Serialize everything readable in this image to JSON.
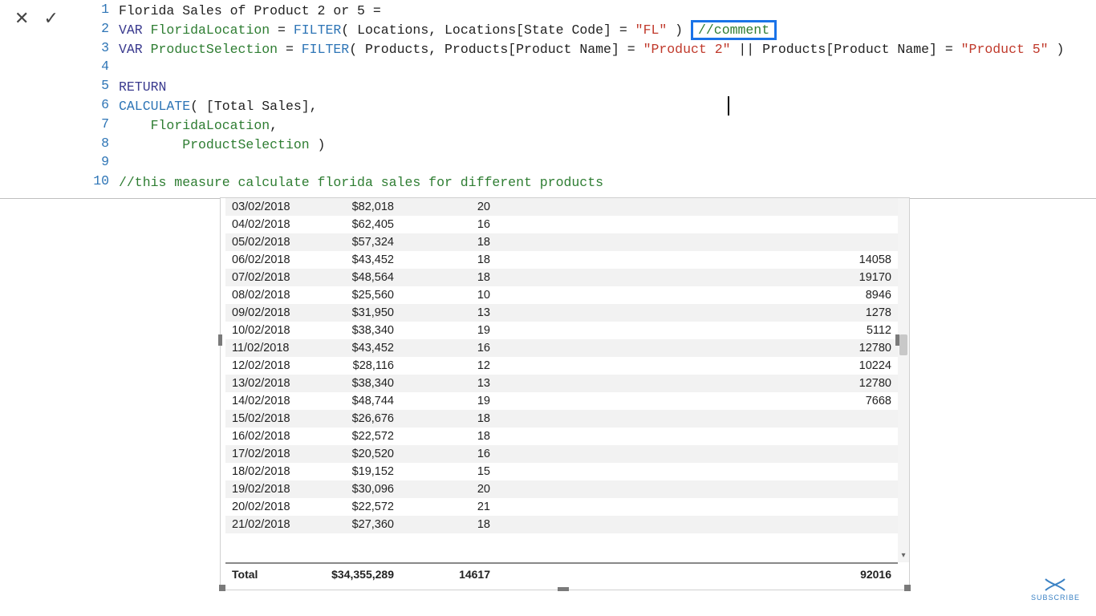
{
  "formula": {
    "line1_measure": "Florida Sales of Product 2 or 5 ",
    "line2_var": "VAR",
    "line2_name": "FloridaLocation",
    "line2_eq": " = ",
    "line2_filter": "FILTER",
    "line2_args_a": "( Locations, Locations[State Code] = ",
    "line2_str": "\"FL\"",
    "line2_close": " ) ",
    "line2_comment": "//comment",
    "line3_var": "VAR",
    "line3_name": "ProductSelection",
    "line3_eq": " = ",
    "line3_filter": "FILTER",
    "line3_args_a": "( Products, Products[Product Name] = ",
    "line3_str1": "\"Product 2\"",
    "line3_mid": " || Products[Product Name] = ",
    "line3_str2": "\"Product 5\"",
    "line3_close": " )",
    "line5_return": "RETURN",
    "line6_calc": "CALCULATE",
    "line6_args": "( [Total Sales],",
    "line7_var": "FloridaLocation",
    "line7_tail": ",",
    "line8_var": "ProductSelection",
    "line8_tail": " )",
    "line10_comment": "//this measure calculate florida sales for different products"
  },
  "line_numbers": [
    "1",
    "2",
    "3",
    "4",
    "5",
    "6",
    "7",
    "8",
    "9",
    "10"
  ],
  "table": {
    "rows": [
      {
        "date": "03/02/2018",
        "sales": "$82,018",
        "qty": "20",
        "extra": ""
      },
      {
        "date": "04/02/2018",
        "sales": "$62,405",
        "qty": "16",
        "extra": ""
      },
      {
        "date": "05/02/2018",
        "sales": "$57,324",
        "qty": "18",
        "extra": ""
      },
      {
        "date": "06/02/2018",
        "sales": "$43,452",
        "qty": "18",
        "extra": "14058"
      },
      {
        "date": "07/02/2018",
        "sales": "$48,564",
        "qty": "18",
        "extra": "19170"
      },
      {
        "date": "08/02/2018",
        "sales": "$25,560",
        "qty": "10",
        "extra": "8946"
      },
      {
        "date": "09/02/2018",
        "sales": "$31,950",
        "qty": "13",
        "extra": "1278"
      },
      {
        "date": "10/02/2018",
        "sales": "$38,340",
        "qty": "19",
        "extra": "5112"
      },
      {
        "date": "11/02/2018",
        "sales": "$43,452",
        "qty": "16",
        "extra": "12780"
      },
      {
        "date": "12/02/2018",
        "sales": "$28,116",
        "qty": "12",
        "extra": "10224"
      },
      {
        "date": "13/02/2018",
        "sales": "$38,340",
        "qty": "13",
        "extra": "12780"
      },
      {
        "date": "14/02/2018",
        "sales": "$48,744",
        "qty": "19",
        "extra": "7668"
      },
      {
        "date": "15/02/2018",
        "sales": "$26,676",
        "qty": "18",
        "extra": ""
      },
      {
        "date": "16/02/2018",
        "sales": "$22,572",
        "qty": "18",
        "extra": ""
      },
      {
        "date": "17/02/2018",
        "sales": "$20,520",
        "qty": "16",
        "extra": ""
      },
      {
        "date": "18/02/2018",
        "sales": "$19,152",
        "qty": "15",
        "extra": ""
      },
      {
        "date": "19/02/2018",
        "sales": "$30,096",
        "qty": "20",
        "extra": ""
      },
      {
        "date": "20/02/2018",
        "sales": "$22,572",
        "qty": "21",
        "extra": ""
      },
      {
        "date": "21/02/2018",
        "sales": "$27,360",
        "qty": "18",
        "extra": ""
      }
    ],
    "total_label": "Total",
    "total_sales": "$34,355,289",
    "total_qty": "14617",
    "total_extra": "92016"
  },
  "subscribe_label": "SUBSCRIBE"
}
